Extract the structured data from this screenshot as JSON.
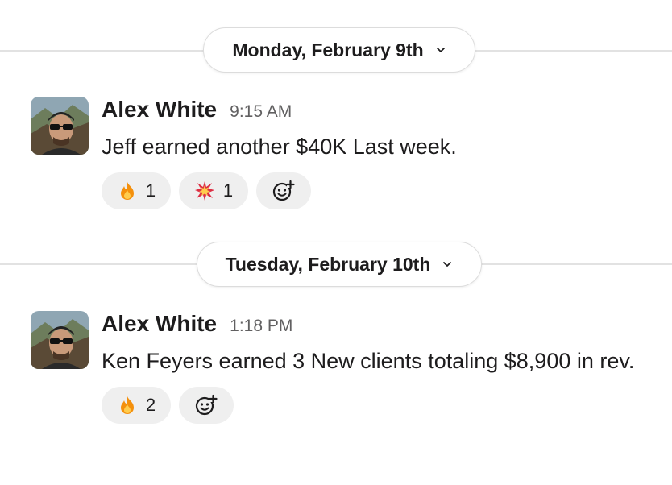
{
  "days": [
    {
      "date_label": "Monday, February 9th",
      "message": {
        "author": "Alex White",
        "time": "9:15 AM",
        "text": "Jeff earned another $40K Last week.",
        "reactions": [
          {
            "emoji": "fire-emoji",
            "count": "1"
          },
          {
            "emoji": "collision-emoji",
            "count": "1"
          }
        ]
      }
    },
    {
      "date_label": "Tuesday, February 10th",
      "message": {
        "author": "Alex White",
        "time": "1:18 PM",
        "text": "Ken Feyers earned 3 New clients totaling $8,900 in rev.",
        "reactions": [
          {
            "emoji": "fire-emoji",
            "count": "2"
          }
        ]
      }
    }
  ]
}
